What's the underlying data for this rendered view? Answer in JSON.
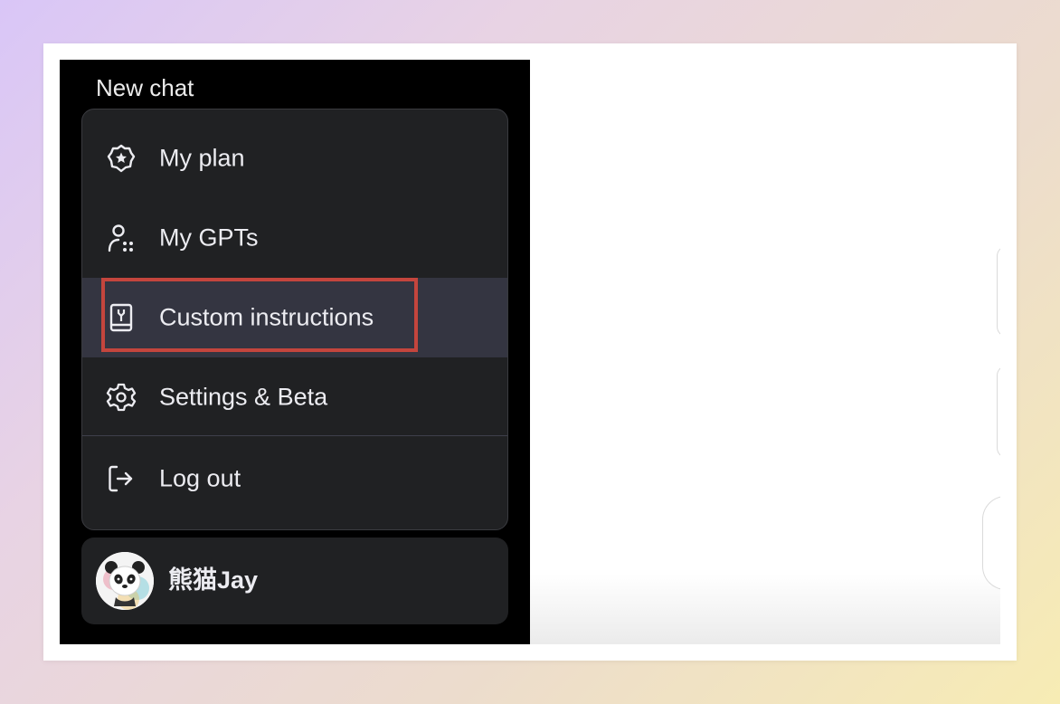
{
  "sidebar": {
    "new_chat_label": "New chat"
  },
  "menu": {
    "items": [
      {
        "label": "My plan",
        "icon": "plan-badge-icon"
      },
      {
        "label": "My GPTs",
        "icon": "gpts-icon"
      },
      {
        "label": "Custom instructions",
        "icon": "instructions-book-icon",
        "active": true
      },
      {
        "label": "Settings & Beta",
        "icon": "gear-icon"
      },
      {
        "label": "Log out",
        "icon": "logout-icon"
      }
    ]
  },
  "user": {
    "name": "熊猫Jay",
    "avatar": "panda-avatar"
  },
  "colors": {
    "sidebar_bg": "#000000",
    "menu_bg": "#202123",
    "active_item_bg": "#343541",
    "highlight_border": "#c4453d",
    "text": "#ececf1"
  }
}
